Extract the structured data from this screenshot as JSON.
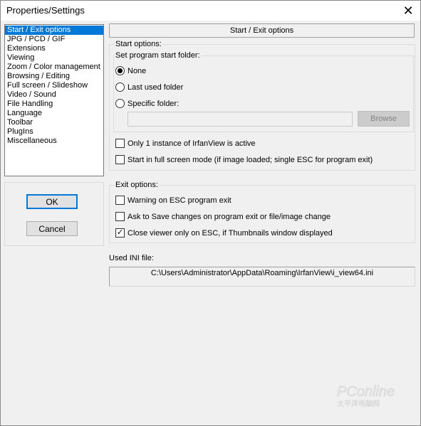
{
  "window": {
    "title": "Properties/Settings",
    "close_glyph": "✕"
  },
  "categories": [
    "Start / Exit options",
    "JPG / PCD / GIF",
    "Extensions",
    "Viewing",
    "Zoom / Color management",
    "Browsing / Editing",
    "Full screen / Slideshow",
    "Video / Sound",
    "File Handling",
    "Language",
    "Toolbar",
    "PlugIns",
    "Miscellaneous"
  ],
  "selected_category_index": 0,
  "buttons": {
    "ok": "OK",
    "cancel": "Cancel"
  },
  "panel": {
    "header": "Start / Exit options",
    "start_options_label": "Start options:",
    "start_folder_label": "Set program start folder:",
    "radio_none": "None",
    "radio_last_used": "Last used folder",
    "radio_specific": "Specific folder:",
    "specific_folder_value": "",
    "browse_label": "Browse",
    "only_one_instance": "Only 1 instance of IrfanView is active",
    "start_fullscreen": "Start in full screen mode (if image loaded; single ESC for program exit)",
    "exit_options_label": "Exit options:",
    "warning_esc": "Warning on ESC program exit",
    "ask_save": "Ask to Save changes on program exit or file/image change",
    "close_viewer": "Close viewer only on ESC, if Thumbnails window displayed",
    "ini_label": "Used INI file:",
    "ini_path": "C:\\Users\\Administrator\\AppData\\Roaming\\IrfanView\\i_view64.ini"
  },
  "state": {
    "selected_radio": "none",
    "only_one_instance": false,
    "start_fullscreen": false,
    "warning_esc": false,
    "ask_save": false,
    "close_viewer": true
  },
  "watermark": {
    "brand": "PConline",
    "sub": "太平洋电脑网"
  },
  "colors": {
    "selection": "#0078d7",
    "dialog_bg": "#f0f0f0"
  }
}
